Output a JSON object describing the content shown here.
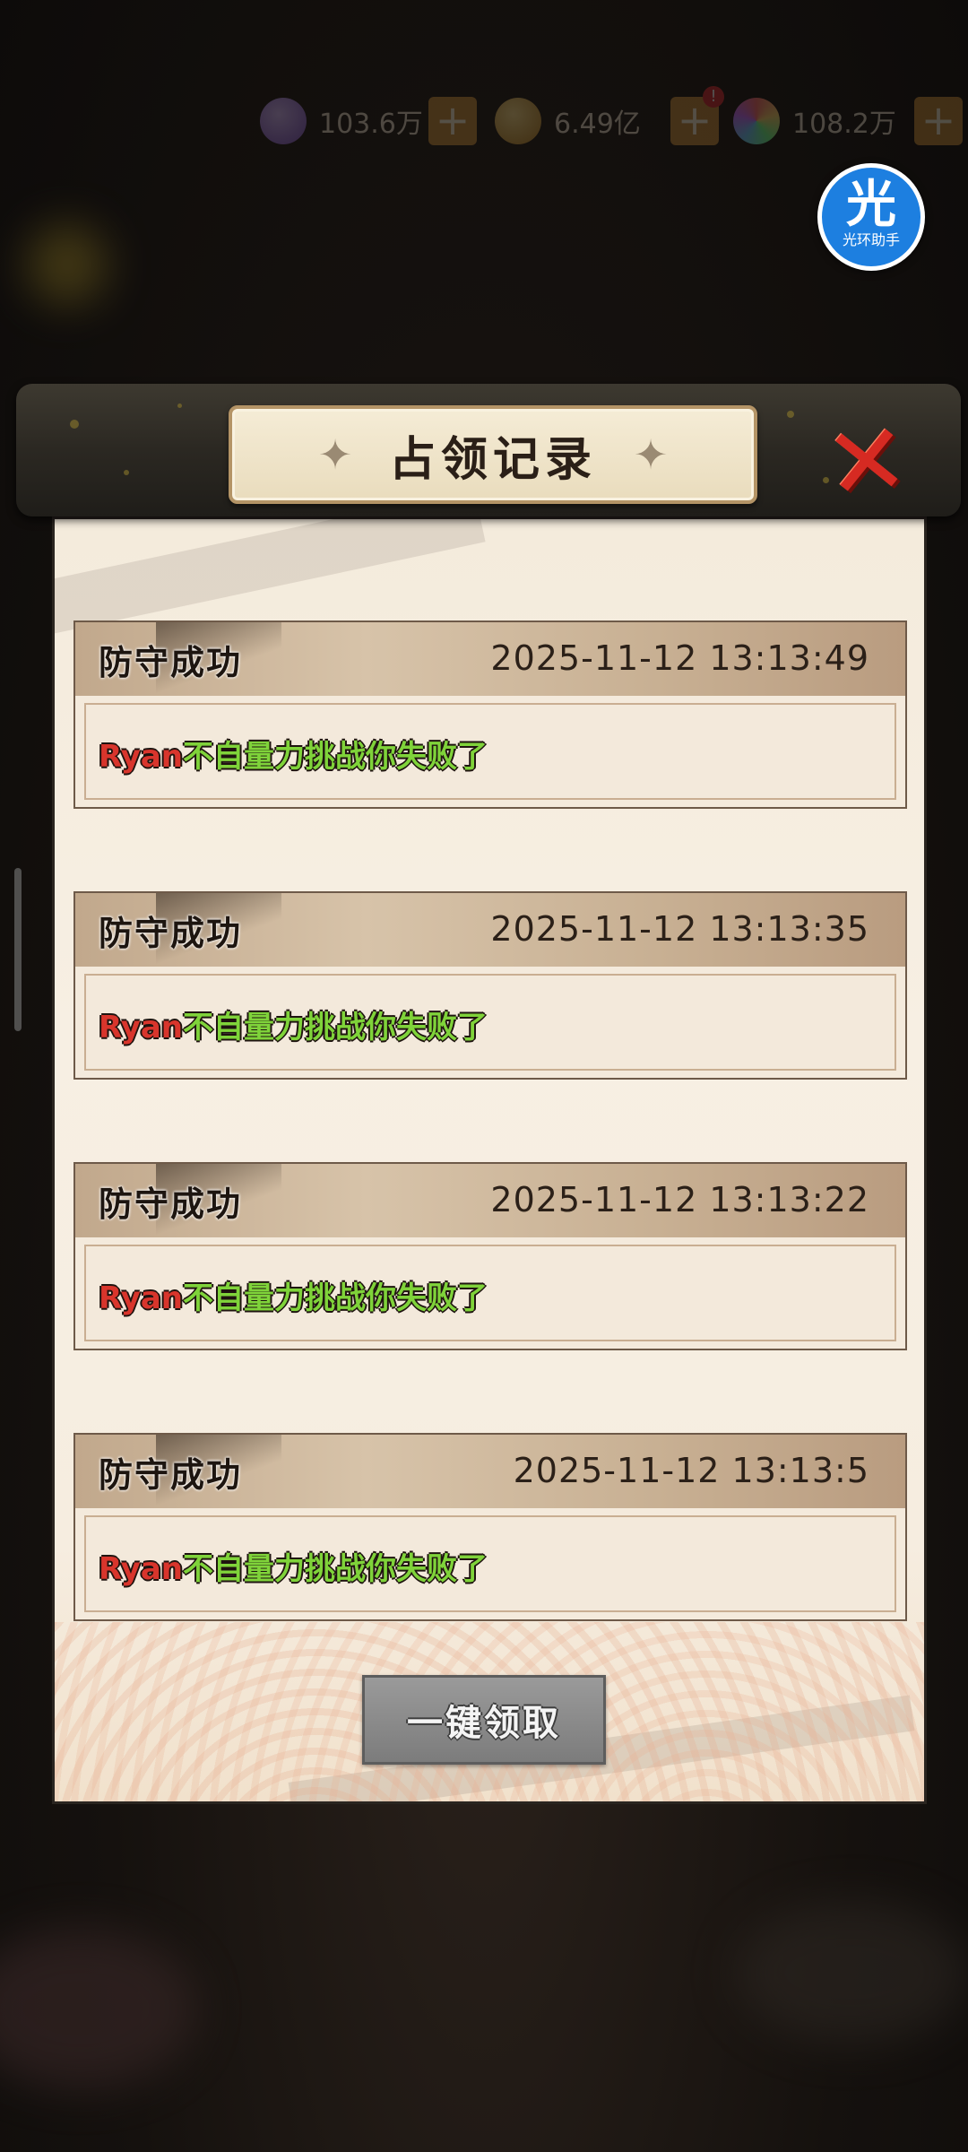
{
  "resources": [
    {
      "icon": "purple-gem-icon",
      "value": "103.6万"
    },
    {
      "icon": "gold-coin-icon",
      "value": "6.49亿",
      "badge": "!"
    },
    {
      "icon": "rainbow-orb-icon",
      "value": "108.2万"
    }
  ],
  "assistant": {
    "glyph": "光",
    "label": "光环助手"
  },
  "dialog": {
    "title": "占领记录",
    "claim_all_label": "一键领取",
    "records": [
      {
        "status": "防守成功",
        "time": "2025-11-12  13:13:49",
        "name": "Ryan",
        "message": "不自量力挑战你失败了"
      },
      {
        "status": "防守成功",
        "time": "2025-11-12  13:13:35",
        "name": "Ryan",
        "message": "不自量力挑战你失败了"
      },
      {
        "status": "防守成功",
        "time": "2025-11-12  13:13:22",
        "name": "Ryan",
        "message": "不自量力挑战你失败了"
      },
      {
        "status": "防守成功",
        "time": "2025-11-12  13:13:5",
        "name": "Ryan",
        "message": "不自量力挑战你失败了"
      }
    ]
  },
  "colors": {
    "accent_red": "#d62a22",
    "message_green": "#7fd33a",
    "name_red": "#d8352c"
  }
}
